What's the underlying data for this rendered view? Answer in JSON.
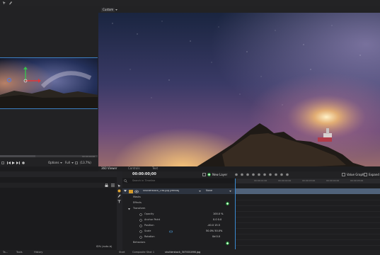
{
  "topbar": {
    "icons": [
      "arrow-icon",
      "pen-icon"
    ]
  },
  "source_panel": {
    "duration": "00:00:00:00",
    "options_label": "Options",
    "quality_label": "Full",
    "zoom_label": "(13.7%)"
  },
  "viewer": {
    "tab_label": "Custom"
  },
  "panel_tabs": [
    {
      "label": "360 Viewer"
    },
    {
      "label": "Controls"
    },
    {
      "label": "Text"
    }
  ],
  "timeline": {
    "timecode": "00:00:00;00",
    "search_placeholder": "Search in Timeline",
    "new_layer_label": "New Layer",
    "value_graph_label": "Value Graph",
    "expand_label": "Expand",
    "layer_name": "shutterstock_198.jpg [Media]",
    "blend_mode": "None",
    "properties": [
      {
        "label": "Masks",
        "value": "",
        "indent": 1
      },
      {
        "label": "Effects",
        "value": "",
        "indent": 1
      },
      {
        "label": "Transform",
        "value": "",
        "indent": 1
      },
      {
        "label": "Opacity",
        "value": "100.0 %",
        "indent": 2
      },
      {
        "label": "Anchor Point",
        "value": "0.0   0.0",
        "indent": 2
      },
      {
        "label": "Position",
        "value": "-40.0   15.5",
        "indent": 2
      },
      {
        "label": "Scale",
        "value": "50.0%   50.0%",
        "indent": 2
      },
      {
        "label": "Rotation",
        "value": "0d   0.0",
        "indent": 2
      },
      {
        "label": "Behaviors",
        "value": "",
        "indent": 1
      }
    ],
    "ruler_ticks": [
      "00:00:01:00",
      "00:00:02:00",
      "00:00:03:00",
      "00:00:04:00",
      "00:00:05:00",
      "00:00:06:00"
    ]
  },
  "left_bottom": {
    "zoom_label": "ID% (auto-b)"
  },
  "bottom_tabs": {
    "left": [
      {
        "label": "Ta..."
      },
      {
        "label": "Tools"
      },
      {
        "label": "History"
      }
    ],
    "right": [
      {
        "label": "Start"
      },
      {
        "label": "Composite Shot 1"
      },
      {
        "label": "shutterstock_307001098.jpg"
      }
    ]
  },
  "colors": {
    "accent_blue": "#4a9ad6",
    "green": "#37c24f",
    "bg": "#1c1c1e"
  }
}
